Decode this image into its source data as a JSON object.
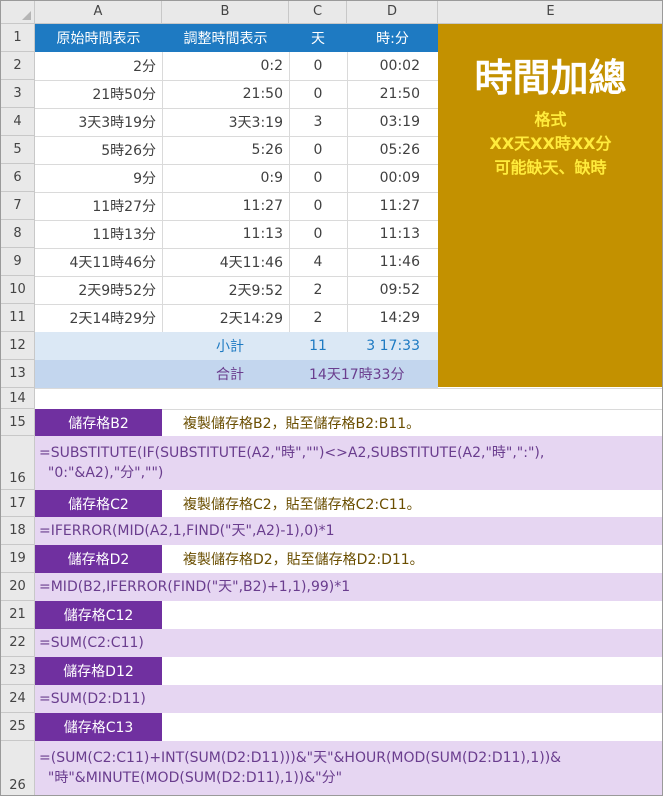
{
  "columns": [
    "A",
    "B",
    "C",
    "D",
    "E"
  ],
  "rows": [
    "1",
    "2",
    "3",
    "4",
    "5",
    "6",
    "7",
    "8",
    "9",
    "10",
    "11",
    "12",
    "13",
    "14",
    "15",
    "16",
    "17",
    "18",
    "19",
    "20",
    "21",
    "22",
    "23",
    "24",
    "25",
    "26"
  ],
  "table": {
    "headers": [
      "原始時間表示",
      "調整時間表示",
      "天",
      "時:分"
    ],
    "data": [
      [
        "2分",
        "0:2",
        "0",
        "00:02"
      ],
      [
        "21時50分",
        "21:50",
        "0",
        "21:50"
      ],
      [
        "3天3時19分",
        "3天3:19",
        "3",
        "03:19"
      ],
      [
        "5時26分",
        "5:26",
        "0",
        "05:26"
      ],
      [
        "9分",
        "0:9",
        "0",
        "00:09"
      ],
      [
        "11時27分",
        "11:27",
        "0",
        "11:27"
      ],
      [
        "11時13分",
        "11:13",
        "0",
        "11:13"
      ],
      [
        "4天11時46分",
        "4天11:46",
        "4",
        "11:46"
      ],
      [
        "2天9時52分",
        "2天9:52",
        "2",
        "09:52"
      ],
      [
        "2天14時29分",
        "2天14:29",
        "2",
        "14:29"
      ]
    ],
    "subtotal": {
      "label": "小計",
      "days": "11",
      "time": "3 17:33"
    },
    "total": {
      "label": "合計",
      "value": "14天17時33分"
    }
  },
  "panel": {
    "title": "時間加總",
    "lines": [
      "格式",
      "XX天XX時XX分",
      "可能缺天、缺時"
    ]
  },
  "sections": [
    {
      "label": "儲存格B2",
      "note": "複製儲存格B2，貼至儲存格B2:B11。",
      "formula": "=SUBSTITUTE(IF(SUBSTITUTE(A2,\"時\",\"\")<>A2,SUBSTITUTE(A2,\"時\",\":\"),\n  \"0:\"&A2),\"分\",\"\")"
    },
    {
      "label": "儲存格C2",
      "note": "複製儲存格C2，貼至儲存格C2:C11。",
      "formula": "=IFERROR(MID(A2,1,FIND(\"天\",A2)-1),0)*1"
    },
    {
      "label": "儲存格D2",
      "note": "複製儲存格D2，貼至儲存格D2:D11。",
      "formula": "=MID(B2,IFERROR(FIND(\"天\",B2)+1,1),99)*1"
    },
    {
      "label": "儲存格C12",
      "note": "",
      "formula": "=SUM(C2:C11)"
    },
    {
      "label": "儲存格D12",
      "note": "",
      "formula": "=SUM(D2:D11)"
    },
    {
      "label": "儲存格C13",
      "note": "",
      "formula": "=(SUM(C2:C11)+INT(SUM(D2:D11)))&\"天\"&HOUR(MOD(SUM(D2:D11),1))&\n  \"時\"&MINUTE(MOD(SUM(D2:D11),1))&\"分\""
    }
  ]
}
